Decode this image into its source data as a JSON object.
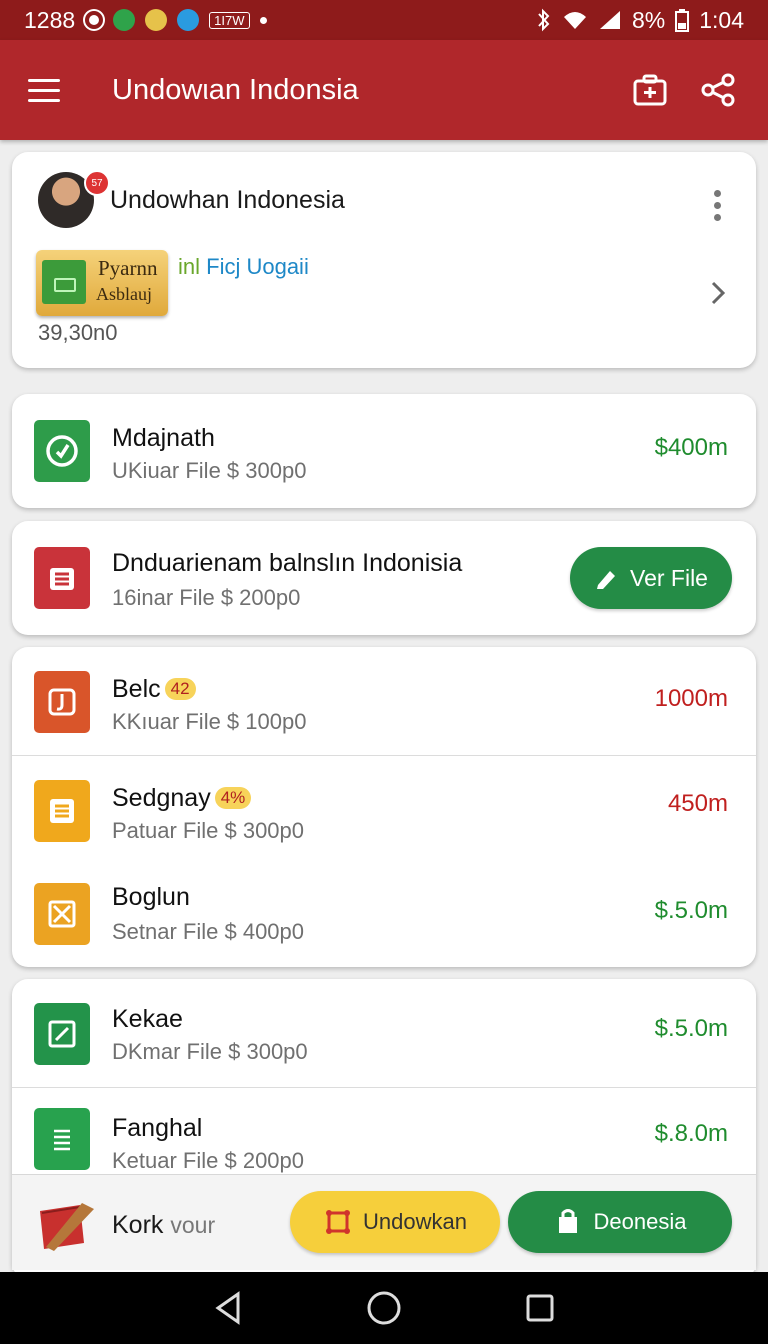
{
  "status_bar": {
    "time_left": "1288",
    "badge": "1I7W",
    "battery": "8%",
    "clock": "1:04"
  },
  "app_bar": {
    "title": "Undowιan Indonsia",
    "icons": [
      "menu-icon",
      "briefcase-icon",
      "share-icon"
    ]
  },
  "profile": {
    "name": "Undowhan Indonesia",
    "avatar_badge": "57",
    "promo_line1": "Pyarnn",
    "promo_line2": "Asblauj",
    "link_prefix": "inl",
    "link_text": "Ficj Uogaii",
    "amount": "39,30n0"
  },
  "files": [
    {
      "title": "Mdajnath",
      "sub": "UKiuar File $ 300p0",
      "amount": "$400m",
      "amount_color": "#1f8c2e",
      "icon": "clock-icon",
      "icon_color": "#2e9c4a"
    },
    {
      "title": "Dnduarienam balnslın Indonisia",
      "sub": "16inar File $ 200p0",
      "button": "Ver File",
      "icon": "stack-icon",
      "icon_color": "#c9333a"
    },
    {
      "title": "Belc",
      "tag": "42",
      "sub": "KKıuar File $ 100p0",
      "amount": "1000m",
      "amount_color": "#c0201f",
      "icon": "hook-icon",
      "icon_color": "#d9552a"
    },
    {
      "title": "Sedgnay",
      "tag": "4%",
      "sub": "Patuar File $ 300p0",
      "amount": "450m",
      "amount_color": "#c0201f",
      "icon": "list-icon",
      "icon_color": "#f0a81c"
    },
    {
      "title": "Boglun",
      "sub": "Setnar File $ 400p0",
      "amount": "$.5.0m",
      "amount_color": "#1f8c2e",
      "icon": "x-doc-icon",
      "icon_color": "#eba322"
    },
    {
      "title": "Kekae",
      "sub": "DKmar File $ 300p0",
      "amount": "$.5.0m",
      "amount_color": "#1f8c2e",
      "icon": "edit-icon",
      "icon_color": "#23934a"
    },
    {
      "title": "Fanghal",
      "sub": "Ketuar File $ 200p0",
      "amount": "$.8.0m",
      "amount_color": "#1f8c2e",
      "icon": "sheet-icon",
      "icon_color": "#28a24e"
    }
  ],
  "bottom_bar": {
    "label_main": "Kork",
    "label_muted": "vour",
    "button_yellow": "Undowkan",
    "button_green": "Deonesia"
  }
}
